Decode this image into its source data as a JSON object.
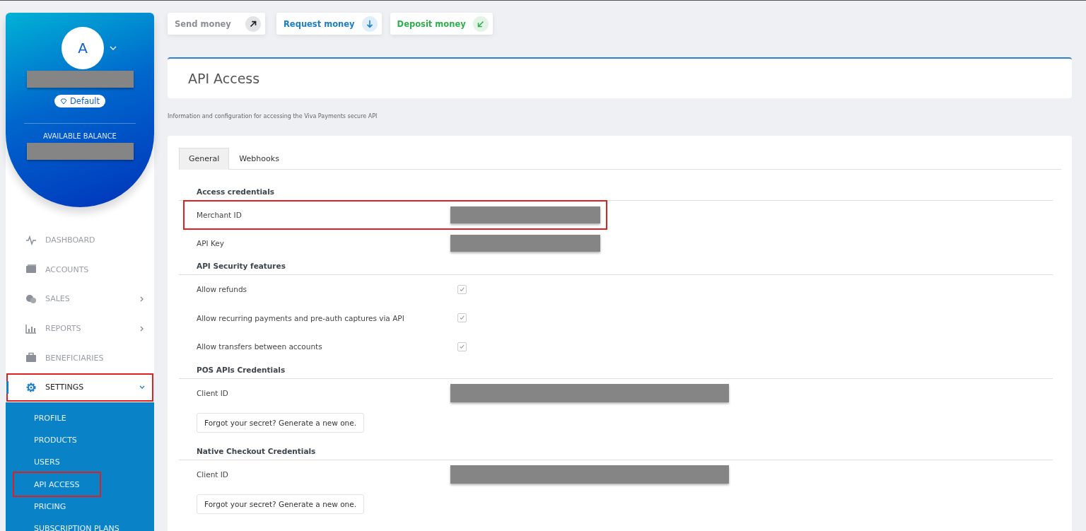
{
  "sidebar": {
    "avatar_initial": "A",
    "badge": "Default",
    "balance_label": "AVAILABLE BALANCE",
    "nav": [
      {
        "label": "DASHBOARD",
        "selected": false,
        "highlighted": false
      },
      {
        "label": "ACCOUNTS",
        "selected": false,
        "highlighted": false
      },
      {
        "label": "SALES",
        "expanded": false,
        "selected": false,
        "highlighted": false
      },
      {
        "label": "REPORTS",
        "expanded": false,
        "selected": false,
        "highlighted": false
      },
      {
        "label": "BENEFICIARIES",
        "selected": false,
        "highlighted": false
      },
      {
        "label": "SETTINGS",
        "expanded": true,
        "selected": true,
        "highlighted": true
      }
    ],
    "subnav": [
      {
        "label": "PROFILE",
        "highlighted": false
      },
      {
        "label": "PRODUCTS",
        "highlighted": false
      },
      {
        "label": "USERS",
        "highlighted": false
      },
      {
        "label": "API ACCESS",
        "highlighted": true
      },
      {
        "label": "PRICING",
        "highlighted": false
      },
      {
        "label": "SUBSCRIPTION PLANS",
        "highlighted": false
      }
    ]
  },
  "actions": [
    {
      "label": "Send money",
      "color": "#8a8f96"
    },
    {
      "label": "Request money",
      "color": "#1a7fc8"
    },
    {
      "label": "Deposit money",
      "color": "#2fae4e"
    }
  ],
  "page": {
    "title": "API Access",
    "description": "Information and configuration for accessing the Viva Payments secure API"
  },
  "tabs": [
    {
      "label": "General",
      "selected": true
    },
    {
      "label": "Webhooks",
      "selected": false
    }
  ],
  "rows": [
    {
      "kind": "heading",
      "label": "Access credentials"
    },
    {
      "kind": "masked",
      "label": "Merchant ID",
      "highlighted": true
    },
    {
      "kind": "masked",
      "label": "API Key",
      "highlighted": false
    },
    {
      "kind": "heading",
      "label": "API Security features"
    },
    {
      "kind": "checkbox",
      "label": "Allow refunds",
      "checked": true
    },
    {
      "kind": "checkbox",
      "label": "Allow recurring payments and pre-auth captures via API",
      "checked": true
    },
    {
      "kind": "checkbox",
      "label": "Allow transfers between accounts",
      "checked": true
    },
    {
      "kind": "heading",
      "label": "POS APIs Credentials"
    },
    {
      "kind": "maskedwide",
      "label": "Client ID",
      "highlighted": false
    },
    {
      "kind": "button",
      "label": "Forgot your secret? Generate a new one."
    },
    {
      "kind": "heading",
      "label": "Native Checkout Credentials"
    },
    {
      "kind": "maskedwide",
      "label": "Client ID",
      "highlighted": false
    },
    {
      "kind": "button",
      "label": "Forgot your secret? Generate a new one."
    }
  ]
}
